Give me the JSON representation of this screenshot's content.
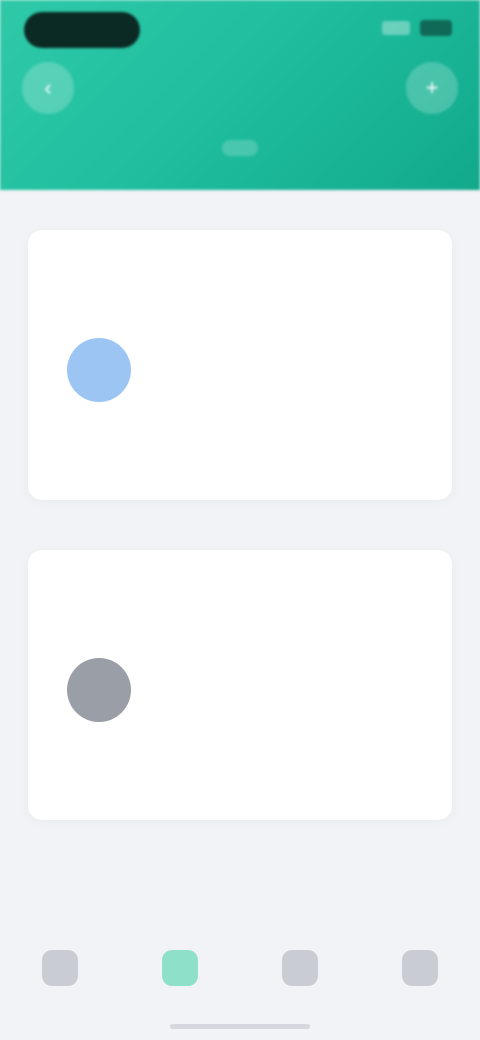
{
  "colors": {
    "header_start": "#2fc9a8",
    "header_end": "#12a98c",
    "accent": "#3cc6a4"
  },
  "status_bar": {
    "time": ""
  },
  "header": {
    "left_icon": "back-icon",
    "right_icon": "add-icon",
    "title": "",
    "tabs": [
      {
        "label": ""
      },
      {
        "label": ""
      },
      {
        "label": ""
      }
    ]
  },
  "cards": [
    {
      "title": "",
      "action": "",
      "people": [
        {
          "name": "",
          "avatar_color": "#9dc5f4"
        }
      ]
    },
    {
      "title": "",
      "action": "",
      "people": [
        {
          "name": "",
          "avatar_color": "#9a9ea6"
        }
      ]
    }
  ],
  "tabbar": {
    "items": [
      {
        "label": "",
        "icon": "home-icon"
      },
      {
        "label": "",
        "icon": "contacts-icon"
      },
      {
        "label": "",
        "icon": "discover-icon"
      },
      {
        "label": "",
        "icon": "profile-icon"
      }
    ]
  }
}
